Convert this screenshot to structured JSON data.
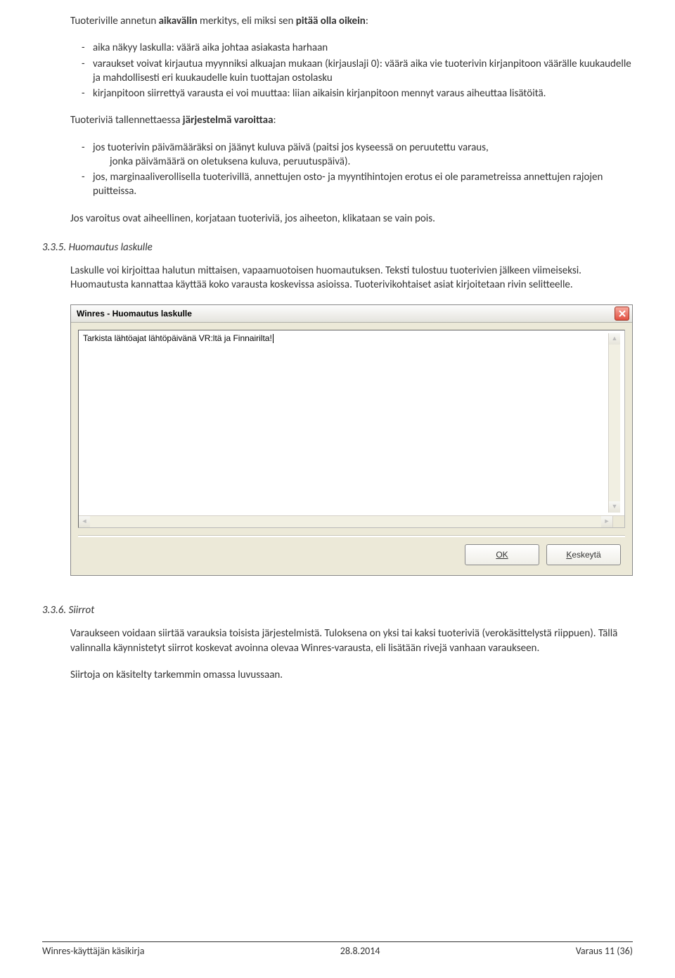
{
  "intro": {
    "lead_plain": "Tuoteriville annetun ",
    "lead_bold1": "aikavälin",
    "lead_mid": " merkitys, eli miksi sen ",
    "lead_bold2": "pitää olla oikein",
    "lead_after": ":"
  },
  "list1": [
    "aika näkyy laskulla: väärä aika johtaa asiakasta harhaan",
    "varaukset voivat kirjautua myynniksi alkuajan mukaan (kirjauslaji 0): väärä aika vie tuoterivin kirjanpitoon väärälle kuukaudelle ja mahdollisesti eri kuukaudelle kuin tuottajan ostolasku",
    "kirjanpitoon siirrettyä varausta ei voi muuttaa: liian aikaisin kirjanpitoon mennyt varaus aiheuttaa lisätöitä."
  ],
  "warn_intro": {
    "pre": "Tuoteriviä tallennettaessa ",
    "bold": "järjestelmä varoittaa",
    "post": ":"
  },
  "list2": [
    {
      "main": "jos tuoterivin päivämääräksi on jäänyt kuluva päivä (paitsi jos kyseessä on peruutettu varaus,",
      "sub": "jonka päivämäärä on oletuksena kuluva, peruutuspäivä)."
    },
    {
      "main": "jos, marginaaliverollisella tuoterivillä, annettujen osto- ja myyntihintojen erotus ei ole parametreissa annettujen rajojen puitteissa.",
      "sub": ""
    }
  ],
  "warn_outro": "Jos varoitus ovat aiheellinen, korjataan tuoteriviä, jos aiheeton, klikataan se vain pois.",
  "section335": {
    "number": "3.3.5.",
    "title": "Huomautus laskulle",
    "body": "Laskulle voi kirjoittaa halutun mittaisen, vapaamuotoisen huomautuksen. Teksti tulostuu tuoterivien jälkeen viimeiseksi. Huomautusta kannattaa käyttää koko varausta koskevissa asioissa. Tuoterivikohtaiset asiat kirjoitetaan rivin selitteelle."
  },
  "dialog": {
    "title": "Winres - Huomautus laskulle",
    "text": "Tarkista lähtöajat lähtöpäivänä VR:ltä ja Finnairilta!",
    "ok": "OK",
    "cancel_u": "K",
    "cancel_rest": "eskeytä"
  },
  "section336": {
    "number": "3.3.6.",
    "title": "Siirrot",
    "p1": "Varaukseen voidaan siirtää varauksia toisista järjestelmistä. Tuloksena on yksi tai kaksi tuoteriviä (verokäsittelystä riippuen). Tällä valinnalla käynnistetyt siirrot koskevat avoinna olevaa Winres-varausta, eli lisätään rivejä vanhaan varaukseen.",
    "p2": "Siirtoja on käsitelty tarkemmin omassa luvussaan."
  },
  "footer": {
    "left": "Winres-käyttäjän käsikirja",
    "center": "28.8.2014",
    "right": "Varaus  11 (36)"
  }
}
